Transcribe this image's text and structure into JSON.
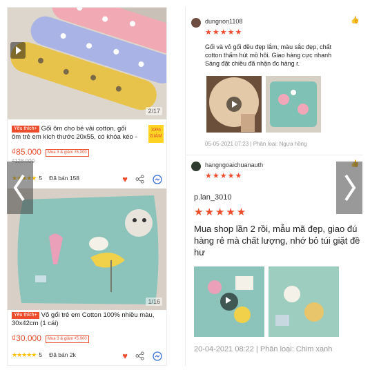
{
  "product1": {
    "pager": "2/17",
    "badge": "Yêu thích+",
    "title_line1": "Gối ôm cho bé vải cotton, gối",
    "title_line2": "ôm trẻ em kích thước 20x55, có khóa kéo -",
    "discount": "33% GIẢM",
    "price": "₫85.000",
    "promo": "Mua 3 & giảm ₫5.000",
    "old_price": "₫128.000",
    "rating": "5",
    "sold": "Đã bán 158"
  },
  "product2": {
    "pager": "1/16",
    "badge": "Yêu thích+",
    "title_line1": "Vỏ gối trẻ em Cotton 100% nhiều màu,",
    "title_line2": "30x42cm (1 cái)",
    "price": "₫30.000",
    "promo": "Mua 3 & giảm ₫5.000",
    "rating": "5",
    "sold": "Đã bán 2k"
  },
  "review1": {
    "user": "dungnon1108",
    "stars": "★★★★★",
    "comment_line1": "Gối và vỏ gối đều đẹp lắm, màu sắc đẹp, chất",
    "comment_line2": "cotton thấm hút mồ hôi. Giao hàng cực nhanh",
    "comment_line3": "Sáng đặt chiều đã nhận đc hàng r.",
    "date": "05-05-2021 07:23 | Phân loại: Ngựa hồng"
  },
  "review2": {
    "user": "hangngoaichuanauth",
    "stars": "★★★★★",
    "user2": "p.lan_3010",
    "stars2": "★★★★★",
    "comment_line1": "Mua shop lần 2 rồi, mẫu mã đẹp, giao đú",
    "comment_line2": "hàng rẻ mà chất lượng, nhớ bỏ túi giặt đề",
    "comment_line3": "hư",
    "date": "20-04-2021 08:22 | Phân loại: Chim xanh"
  },
  "colors": {
    "accent": "#ee4d2d",
    "star": "#ffbf00"
  }
}
